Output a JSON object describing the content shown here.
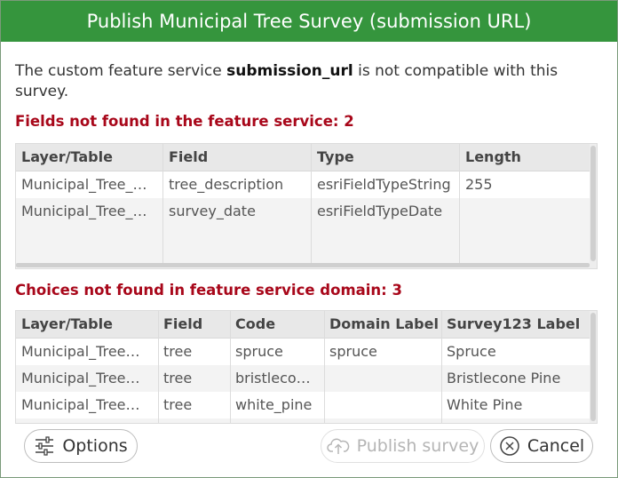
{
  "dialog": {
    "title": "Publish Municipal Tree Survey (submission URL)",
    "message_prefix": "The custom feature service ",
    "message_bold": "submission_url",
    "message_suffix": " is not compatible with this survey."
  },
  "fields_section": {
    "heading": "Fields not found in the feature service: 2",
    "columns": [
      "Layer/Table",
      "Field",
      "Type",
      "Length"
    ],
    "rows": [
      [
        "Municipal_Tree_…",
        "tree_description",
        "esriFieldTypeString",
        "255"
      ],
      [
        "Municipal_Tree_…",
        "survey_date",
        "esriFieldTypeDate",
        ""
      ]
    ]
  },
  "choices_section": {
    "heading": "Choices not found in feature service domain: 3",
    "columns": [
      "Layer/Table",
      "Field",
      "Code",
      "Domain Label",
      "Survey123 Label"
    ],
    "rows": [
      [
        "Municipal_Tree…",
        "tree",
        "spruce",
        "spruce",
        "Spruce"
      ],
      [
        "Municipal_Tree…",
        "tree",
        "bristleco…",
        "",
        "Bristlecone Pine"
      ],
      [
        "Municipal_Tree…",
        "tree",
        "white_pine",
        "",
        "White Pine"
      ]
    ]
  },
  "buttons": {
    "options": "Options",
    "publish": "Publish survey",
    "cancel": "Cancel"
  },
  "icons": {
    "options": "sliders-icon",
    "publish": "cloud-upload-icon",
    "cancel": "close-circle-icon"
  },
  "colors": {
    "titlebar": "#35953d",
    "error_heading": "#a8071a"
  }
}
